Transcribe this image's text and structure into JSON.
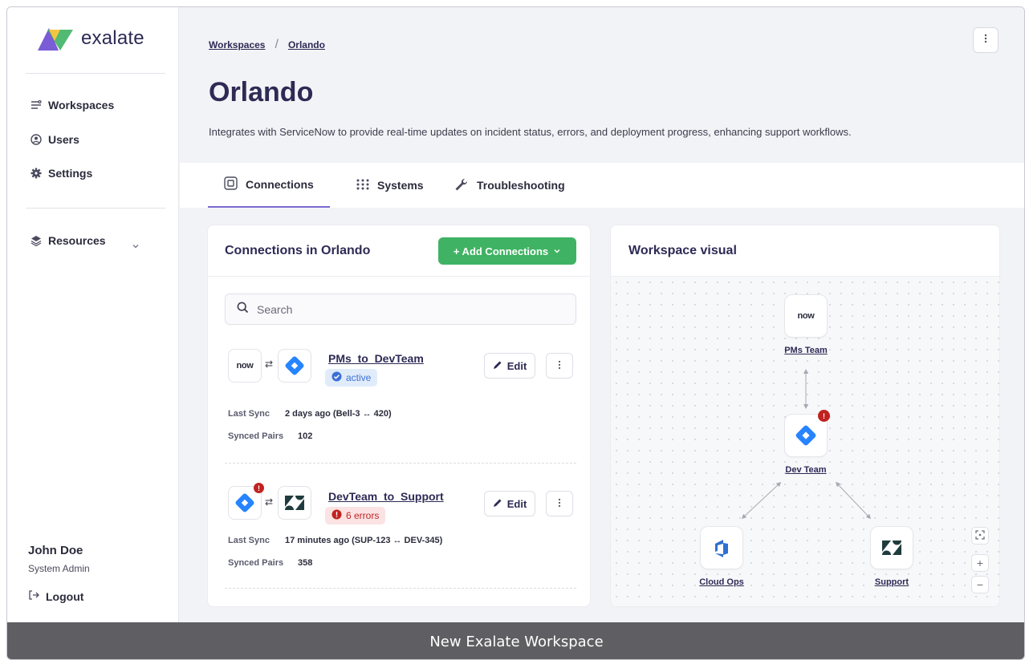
{
  "app": {
    "logo_text": "exalate"
  },
  "sidebar": {
    "items": [
      {
        "label": "Workspaces",
        "icon": "workspaces-icon"
      },
      {
        "label": "Users",
        "icon": "users-icon"
      },
      {
        "label": "Settings",
        "icon": "gear-icon"
      }
    ],
    "resources_label": "Resources",
    "user": {
      "name": "John Doe",
      "role": "System Admin"
    },
    "logout_label": "Logout"
  },
  "breadcrumb": {
    "root": "Workspaces",
    "current": "Orlando"
  },
  "page": {
    "title": "Orlando",
    "description": "Integrates with ServiceNow to provide real-time updates on incident status, errors, and deployment progress, enhancing support workflows."
  },
  "tabs": [
    {
      "label": "Connections",
      "active": true
    },
    {
      "label": "Systems",
      "active": false
    },
    {
      "label": "Troubleshooting",
      "active": false
    }
  ],
  "connections_panel": {
    "title": "Connections in Orlando",
    "add_label": "+ Add Connections",
    "search_placeholder": "Search",
    "edit_label": "Edit",
    "last_sync_label": "Last Sync",
    "synced_pairs_label": "Synced Pairs",
    "items": [
      {
        "name": "PMs_to_DevTeam",
        "from_system": "now",
        "status": "active",
        "last_sync": "2 days ago (Bell-3 ↔ 420)",
        "synced_pairs": "102"
      },
      {
        "name": "DevTeam_to_Support",
        "status": "6 errors",
        "error_marker": "!",
        "last_sync": "17 minutes ago (SUP-123 ↔ DEV-345)",
        "synced_pairs": "358"
      }
    ]
  },
  "workspace_visual": {
    "title": "Workspace visual",
    "nodes": [
      {
        "label": "PMs Team",
        "logo": "now"
      },
      {
        "label": "Dev Team",
        "error_marker": "!"
      },
      {
        "label": "Cloud Ops"
      },
      {
        "label": "Support"
      }
    ]
  },
  "caption": "New Exalate Workspace",
  "colors": {
    "brand": "#2d2a55",
    "accent": "#7b6ad0",
    "success": "#3fb363",
    "error": "#c0231f",
    "jira": "#2684ff"
  }
}
